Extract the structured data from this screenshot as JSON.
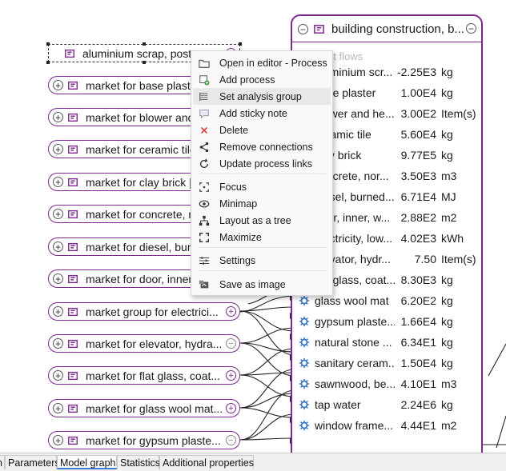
{
  "colors": {
    "node_border": "#7b2a8c",
    "link": "#222222",
    "flow_icon": "#3b78c4",
    "menu_hover": "#e8e8e8",
    "active_tab_underline": "#3a7bd5"
  },
  "process_nodes": [
    {
      "label": "aluminium scrap, post-co",
      "left_expander": "",
      "right_expander": "+",
      "selected": true
    },
    {
      "label": "market for base plaster",
      "left_expander": "+",
      "right_expander": ""
    },
    {
      "label": "market for blower and h",
      "left_expander": "+",
      "right_expander": ""
    },
    {
      "label": "market for ceramic tile",
      "left_expander": "+",
      "right_expander": ""
    },
    {
      "label": "market for clay brick | c",
      "left_expander": "+",
      "right_expander": ""
    },
    {
      "label": "market for concrete, nor",
      "left_expander": "+",
      "right_expander": ""
    },
    {
      "label": "market for diesel, burne",
      "left_expander": "+",
      "right_expander": ""
    },
    {
      "label": "market for door, inner, w",
      "left_expander": "+",
      "right_expander": ""
    },
    {
      "label": "market group for electrici...",
      "left_expander": "+",
      "right_expander": "+"
    },
    {
      "label": "market for elevator, hydra...",
      "left_expander": "+",
      "right_expander": "−"
    },
    {
      "label": "market for flat glass, coat...",
      "left_expander": "+",
      "right_expander": "+"
    },
    {
      "label": "market for glass wool mat...",
      "left_expander": "+",
      "right_expander": "+"
    },
    {
      "label": "market for gypsum plaste...",
      "left_expander": "+",
      "right_expander": "−"
    }
  ],
  "main_process": {
    "title": "building construction, b...",
    "left_expander": "−",
    "right_expander": "−",
    "section_title": "Input flows",
    "flows": [
      {
        "name": "aluminium scr...",
        "amount": "-2.25E3",
        "unit": "kg"
      },
      {
        "name": "base plaster",
        "amount": "1.00E4",
        "unit": "kg"
      },
      {
        "name": "blower and he...",
        "amount": "3.00E2",
        "unit": "Item(s)"
      },
      {
        "name": "ceramic tile",
        "amount": "5.60E4",
        "unit": "kg"
      },
      {
        "name": "clay brick",
        "amount": "9.77E5",
        "unit": "kg"
      },
      {
        "name": "concrete, nor...",
        "amount": "3.50E3",
        "unit": "m3"
      },
      {
        "name": "diesel, burned...",
        "amount": "6.71E4",
        "unit": "MJ"
      },
      {
        "name": "door, inner, w...",
        "amount": "2.88E2",
        "unit": "m2"
      },
      {
        "name": "electricity, low...",
        "amount": "4.02E3",
        "unit": "kWh"
      },
      {
        "name": "elevator, hydr...",
        "amount": "7.50",
        "unit": "Item(s)"
      },
      {
        "name": "flat glass, coat...",
        "amount": "8.30E3",
        "unit": "kg"
      },
      {
        "name": "glass wool mat",
        "amount": "6.20E2",
        "unit": "kg"
      },
      {
        "name": "gypsum plaste...",
        "amount": "1.66E4",
        "unit": "kg"
      },
      {
        "name": "natural stone ...",
        "amount": "6.34E1",
        "unit": "kg"
      },
      {
        "name": "sanitary ceram...",
        "amount": "1.50E4",
        "unit": "kg"
      },
      {
        "name": "sawnwood, be...",
        "amount": "4.10E1",
        "unit": "m3"
      },
      {
        "name": "tap water",
        "amount": "2.24E6",
        "unit": "kg"
      },
      {
        "name": "window frame...",
        "amount": "4.44E1",
        "unit": "m2"
      }
    ]
  },
  "context_menu": {
    "hovered_index": 2,
    "items": [
      {
        "label": "Open in editor - Process",
        "icon": "folder-icon"
      },
      {
        "label": "Add process",
        "icon": "add-process-icon"
      },
      {
        "label": "Set analysis group",
        "icon": "group-icon"
      },
      {
        "label": "Add sticky note",
        "icon": "sticky-note-icon"
      },
      {
        "label": "Delete",
        "icon": "delete-x-icon"
      },
      {
        "label": "Remove connections",
        "icon": "remove-connections-icon"
      },
      {
        "label": "Update process links",
        "icon": "update-links-icon"
      },
      {
        "label": "Focus",
        "icon": "focus-icon"
      },
      {
        "label": "Minimap",
        "icon": "minimap-icon"
      },
      {
        "label": "Layout as a tree",
        "icon": "tree-layout-icon"
      },
      {
        "label": "Maximize",
        "icon": "maximize-icon"
      },
      {
        "label": "Settings",
        "icon": "settings-sliders-icon"
      },
      {
        "label": "Save as image",
        "icon": "save-image-icon"
      }
    ]
  },
  "tabs": [
    {
      "label": "n",
      "active": false
    },
    {
      "label": "Parameters",
      "active": false
    },
    {
      "label": "Model graph",
      "active": true
    },
    {
      "label": "Statistics",
      "active": false
    },
    {
      "label": "Additional properties",
      "active": false
    }
  ]
}
